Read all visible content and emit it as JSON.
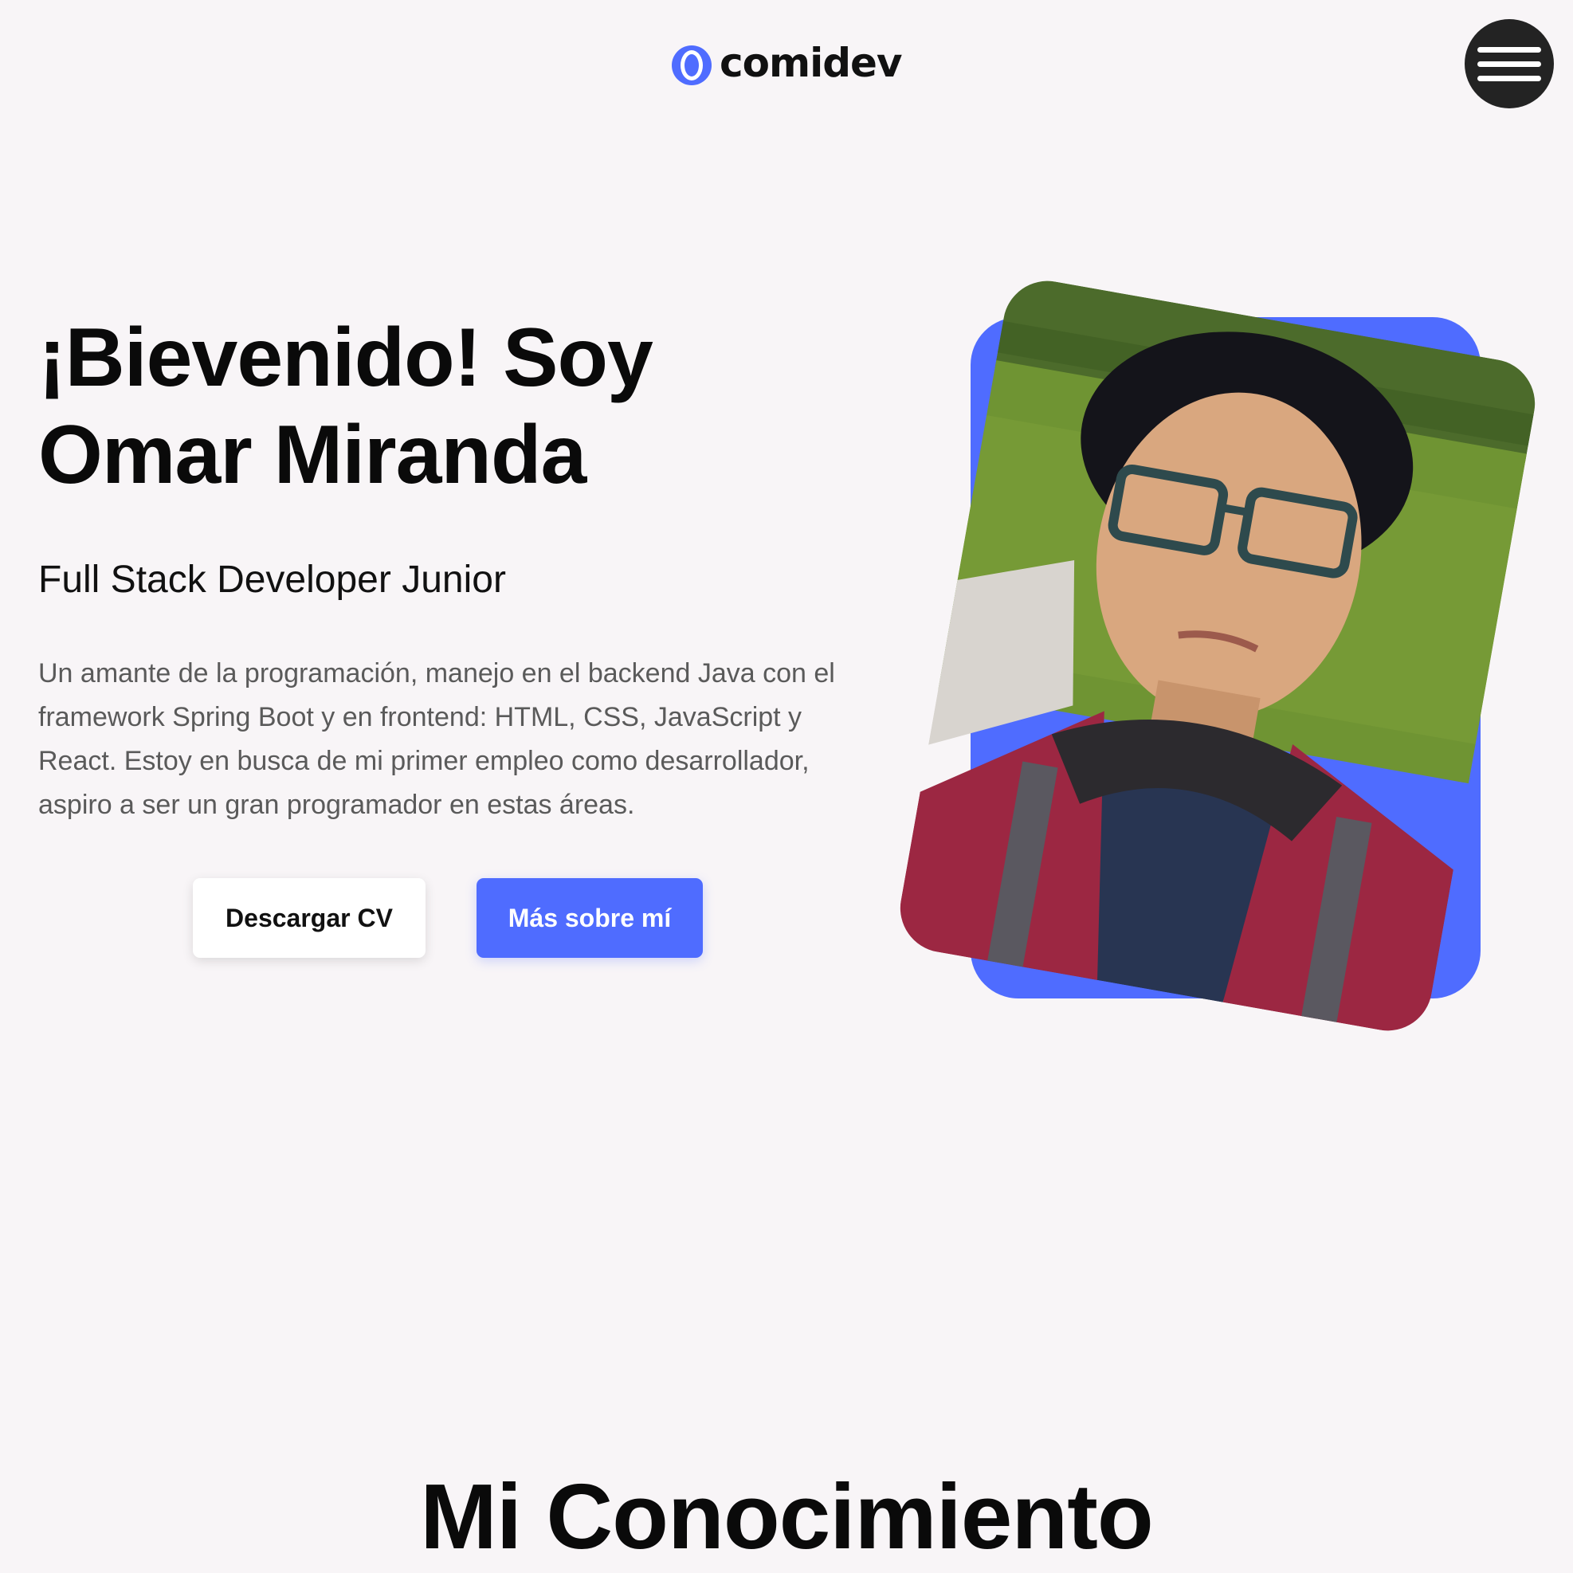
{
  "header": {
    "logo_text": "comidev",
    "menu_icon": "hamburger-menu-icon"
  },
  "hero": {
    "title": "¡Bievenido! Soy Omar Miranda",
    "subtitle": "Full Stack Developer Junior",
    "description": "Un amante de la programación, manejo en el backend Java con el framework Spring Boot y en frontend: HTML, CSS, JavaScript y React. Estoy en busca de mi primer empleo como desarrollador, aspiro a ser un gran programador en estas áreas.",
    "buttons": {
      "download_cv": "Descargar CV",
      "more_about": "Más sobre mí"
    }
  },
  "knowledge": {
    "title": "Mi Conocimiento"
  },
  "colors": {
    "accent": "#4f6cff",
    "background": "#f8f5f7",
    "text": "#0a0a0a",
    "muted_text": "#5a5a5a",
    "menu_button": "#232323"
  }
}
